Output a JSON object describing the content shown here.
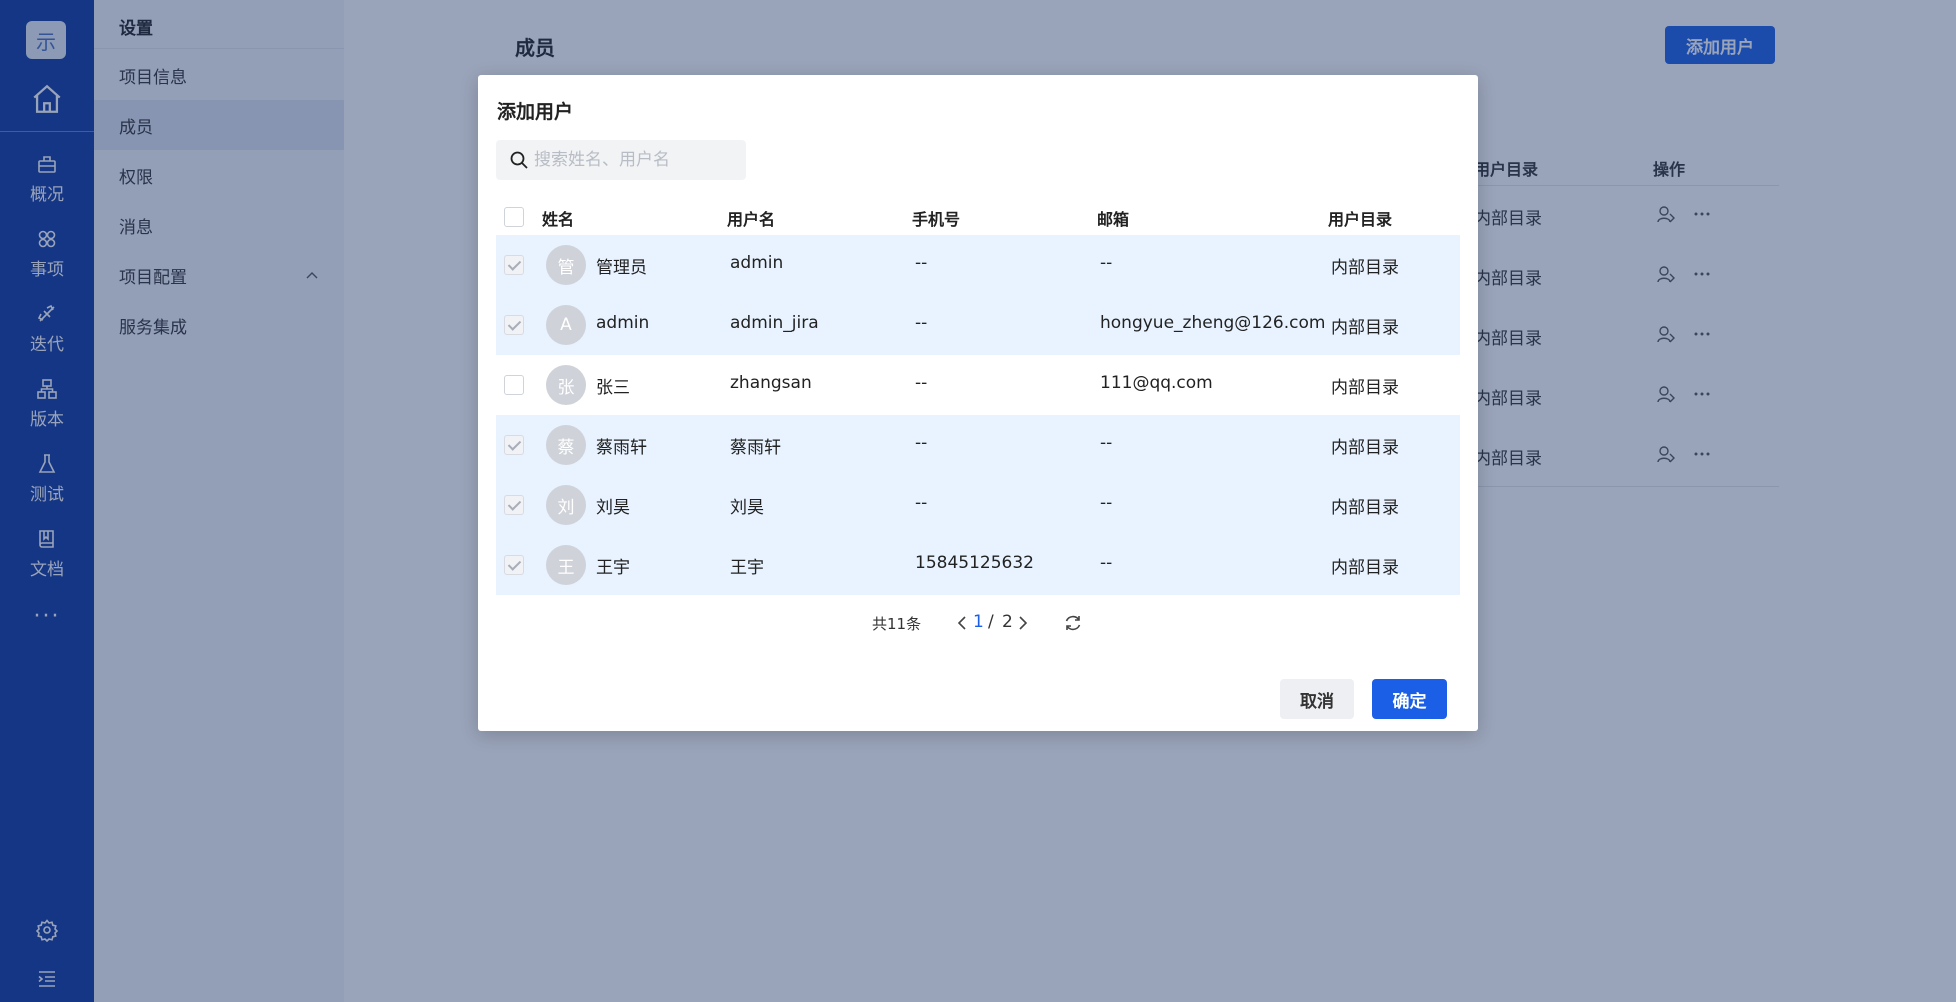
{
  "rail": {
    "logo_char": "示",
    "items": [
      {
        "label": "概况",
        "icon": "overview-icon"
      },
      {
        "label": "事项",
        "icon": "issues-icon"
      },
      {
        "label": "迭代",
        "icon": "sprint-icon"
      },
      {
        "label": "版本",
        "icon": "version-icon"
      },
      {
        "label": "测试",
        "icon": "test-icon"
      },
      {
        "label": "文档",
        "icon": "docs-icon"
      }
    ],
    "more": "···"
  },
  "settings": {
    "title": "设置",
    "items": [
      "项目信息",
      "成员",
      "权限",
      "消息",
      "项目配置",
      "服务集成"
    ],
    "active_index": 1
  },
  "main": {
    "page_title": "成员",
    "add_button": "添加用户",
    "table_headers": {
      "directory": "用户目录",
      "actions": "操作"
    },
    "row_directory": "内部目录"
  },
  "modal": {
    "title": "添加用户",
    "search_placeholder": "搜索姓名、用户名",
    "headers": {
      "name": "姓名",
      "username": "用户名",
      "phone": "手机号",
      "email": "邮箱",
      "directory": "用户目录"
    },
    "rows": [
      {
        "avatar": "管",
        "name": "管理员",
        "username": "admin",
        "phone": "--",
        "email": "--",
        "directory": "内部目录",
        "checked": true
      },
      {
        "avatar": "A",
        "name": "admin",
        "username": "admin_jira",
        "phone": "--",
        "email": "hongyue_zheng@126.com",
        "directory": "内部目录",
        "checked": true
      },
      {
        "avatar": "张",
        "name": "张三",
        "username": "zhangsan",
        "phone": "--",
        "email": "111@qq.com",
        "directory": "内部目录",
        "checked": false
      },
      {
        "avatar": "蔡",
        "name": "蔡雨轩",
        "username": "蔡雨轩",
        "phone": "--",
        "email": "--",
        "directory": "内部目录",
        "checked": true
      },
      {
        "avatar": "刘",
        "name": "刘昊",
        "username": "刘昊",
        "phone": "--",
        "email": "--",
        "directory": "内部目录",
        "checked": true
      },
      {
        "avatar": "王",
        "name": "王宇",
        "username": "王宇",
        "phone": "15845125632",
        "email": "--",
        "directory": "内部目录",
        "checked": true
      }
    ],
    "pagination": {
      "total": "共11条",
      "current": "1",
      "slash": "/",
      "pages": "2"
    },
    "cancel": "取消",
    "confirm": "确定"
  }
}
